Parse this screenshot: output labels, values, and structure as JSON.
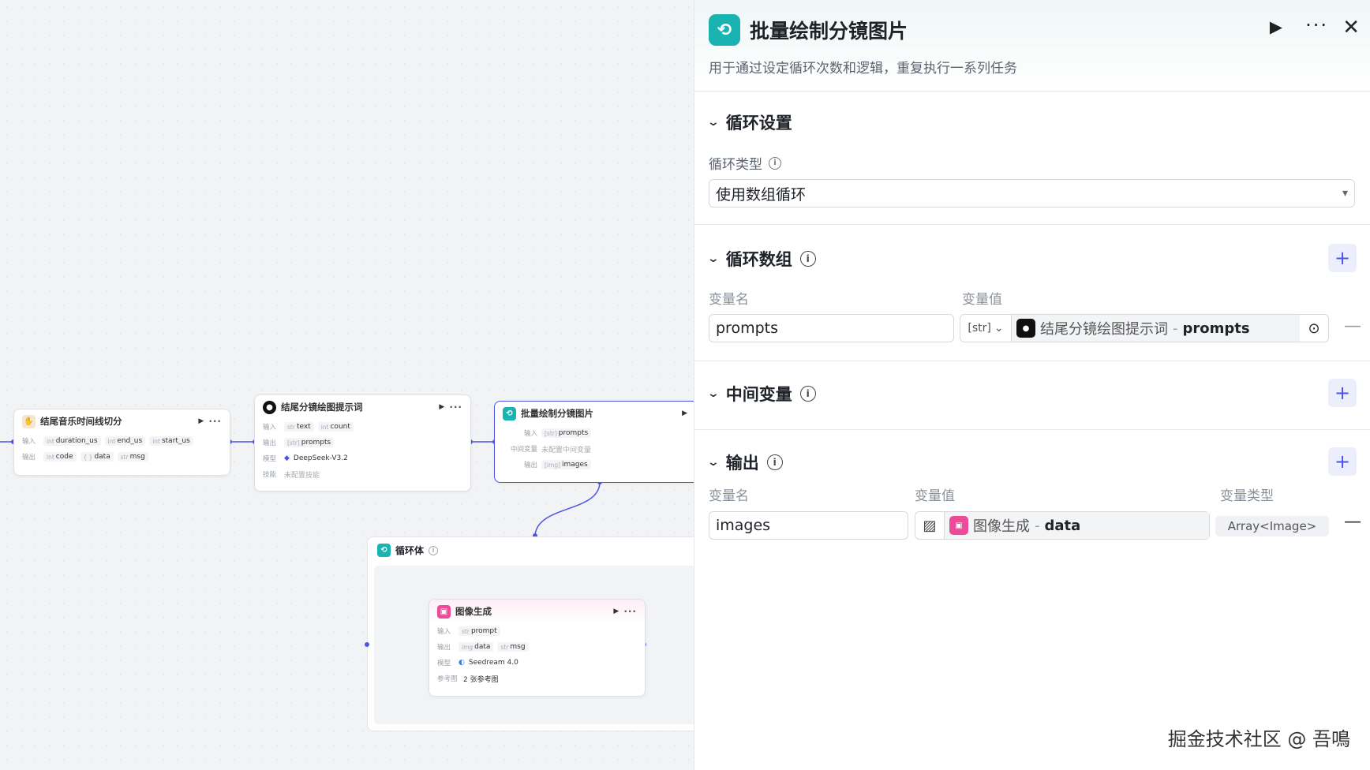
{
  "canvas": {
    "node1": {
      "title": "结尾音乐时间线切分",
      "in_label": "输入",
      "out_label": "输出",
      "inputs": [
        {
          "type": "int",
          "name": "duration_us"
        },
        {
          "type": "int",
          "name": "end_us"
        },
        {
          "type": "int",
          "name": "start_us"
        }
      ],
      "outputs": [
        {
          "type": "int",
          "name": "code"
        },
        {
          "type": "{ }",
          "name": "data"
        },
        {
          "type": "str",
          "name": "msg"
        }
      ]
    },
    "node2": {
      "title": "结尾分镜绘图提示词",
      "in_label": "输入",
      "out_label": "输出",
      "model_label": "模型",
      "skill_label": "技能",
      "inputs": [
        {
          "type": "str",
          "name": "text"
        },
        {
          "type": "int",
          "name": "count"
        }
      ],
      "outputs": [
        {
          "type": "[str]",
          "name": "prompts"
        }
      ],
      "model": "DeepSeek-V3.2",
      "skill": "未配置技能"
    },
    "node3": {
      "title": "批量绘制分镜图片",
      "in_label": "输入",
      "mid_label": "中间变量",
      "out_label": "输出",
      "input": {
        "type": "[str]",
        "name": "prompts"
      },
      "mid": "未配置中间变量",
      "output": {
        "type": "[img]",
        "name": "images"
      }
    },
    "loop": {
      "title": "循环体"
    },
    "node4": {
      "title": "图像生成",
      "in_label": "输入",
      "out_label": "输出",
      "model_label": "模型",
      "ref_label": "参考图",
      "input": {
        "type": "str",
        "name": "prompt"
      },
      "outputs": [
        {
          "type": "img",
          "name": "data"
        },
        {
          "type": "str",
          "name": "msg"
        }
      ],
      "model": "Seedream 4.0",
      "ref": "2 张参考图"
    }
  },
  "panel": {
    "title": "批量绘制分镜图片",
    "desc": "用于通过设定循环次数和逻辑，重复执行一系列任务",
    "sec_loop_settings": {
      "title": "循环设置",
      "type_label": "循环类型",
      "type_value": "使用数组循环"
    },
    "sec_loop_array": {
      "title": "循环数组",
      "col_name": "变量名",
      "col_value": "变量值",
      "var_name": "prompts",
      "var_type": "[str]",
      "ref_node": "结尾分镜绘图提示词",
      "ref_sep": "-",
      "ref_field": "prompts"
    },
    "sec_mid": {
      "title": "中间变量"
    },
    "sec_output": {
      "title": "输出",
      "col_name": "变量名",
      "col_value": "变量值",
      "col_type": "变量类型",
      "var_name": "images",
      "ref_node": "图像生成",
      "ref_sep": "-",
      "ref_field": "data",
      "var_type": "Array<Image>"
    }
  },
  "watermark": "掘金技术社区 @ 吾鳴"
}
